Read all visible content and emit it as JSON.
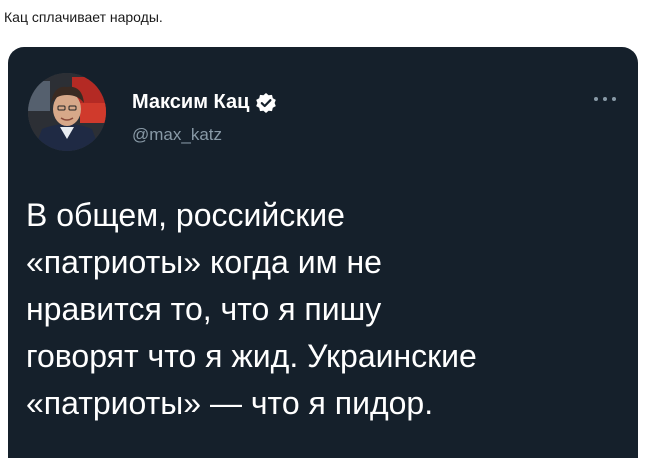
{
  "post": {
    "caption": "Кац сплачивает народы."
  },
  "tweet": {
    "display_name": "Максим Кац",
    "handle": "@max_katz",
    "text_lines": [
      "В общем, российские",
      "«патриоты» когда им не",
      "нравится то, что я пишу",
      "говорят что я жид. Украинские",
      "«патриоты» — что я пидор."
    ],
    "icons": {
      "verified": "verified-badge-icon",
      "more": "more-options-icon"
    },
    "colors": {
      "background": "#15202b",
      "text": "#ffffff",
      "secondary_text": "#8899a6"
    }
  }
}
